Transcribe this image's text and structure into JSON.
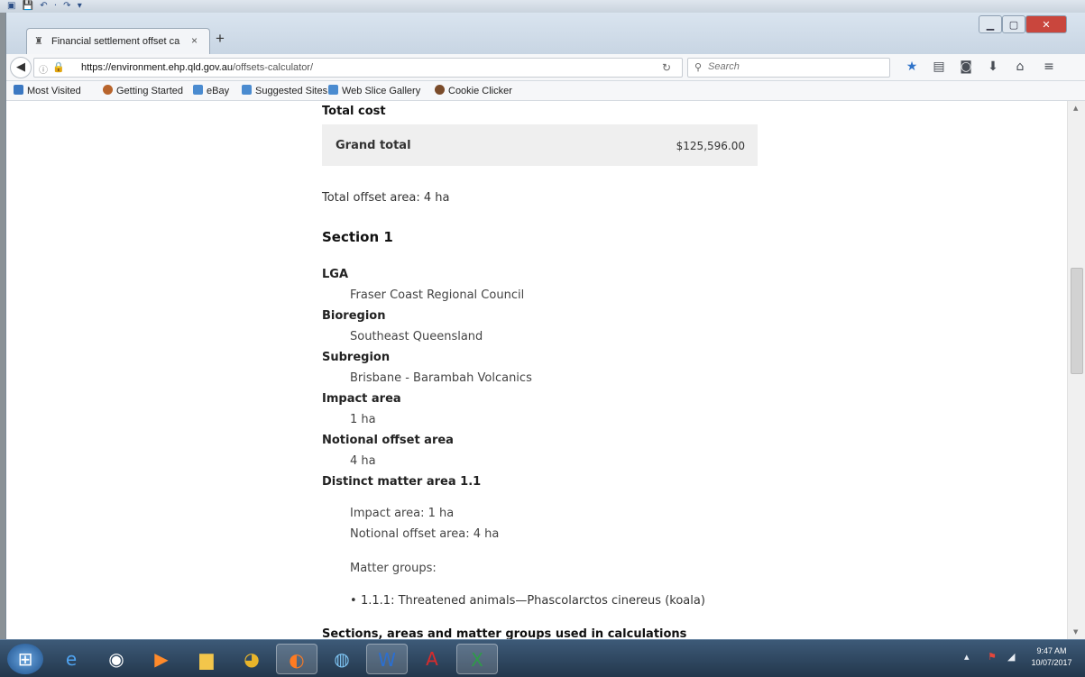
{
  "browser": {
    "tab_title": "Financial settlement offset ca",
    "tab_close": "×",
    "new_tab": "+",
    "url_host": "https://environment.ehp.qld.gov.au",
    "url_path": "/offsets-calculator/",
    "search_placeholder": "Search",
    "bookmarks": [
      {
        "label": "Most Visited",
        "color": "#3b78c2"
      },
      {
        "label": "Getting Started",
        "color": "#b8642c"
      },
      {
        "label": "eBay",
        "color": "#4a8bd0"
      },
      {
        "label": "Suggested Sites",
        "color": "#4a8bd0"
      },
      {
        "label": "Web Slice Gallery",
        "color": "#4a8bd0"
      },
      {
        "label": "Cookie Clicker",
        "color": "#7a4b2a"
      }
    ]
  },
  "page": {
    "total_cost_heading": "Total cost",
    "grand_total_label": "Grand total",
    "grand_total_value": "$125,596.00",
    "total_offset_area": "Total offset area: 4 ha",
    "section_title": "Section 1",
    "lga_label": "LGA",
    "lga_value": "Fraser Coast Regional Council",
    "bioregion_label": "Bioregion",
    "bioregion_value": "Southeast Queensland",
    "subregion_label": "Subregion",
    "subregion_value": "Brisbane - Barambah Volcanics",
    "impact_area_label": "Impact area",
    "impact_area_value": "1 ha",
    "notional_label": "Notional offset area",
    "notional_value": "4 ha",
    "distinct_label": "Distinct matter area 1.1",
    "distinct_impact": "Impact area: 1 ha",
    "distinct_notional": "Notional offset area: 4 ha",
    "matter_groups_label": "Matter groups:",
    "matter_group_item": "1.1.1: Threatened animals—Phascolarctos cinereus (koala)",
    "next_heading": "Sections, areas and matter groups used in calculations"
  },
  "taskbar": {
    "time": "9:47 AM",
    "date": "10/07/2017"
  },
  "colors": {
    "accent": "#2f73c9",
    "close_button": "#c9463d",
    "grand_total_bg": "#efefef"
  }
}
